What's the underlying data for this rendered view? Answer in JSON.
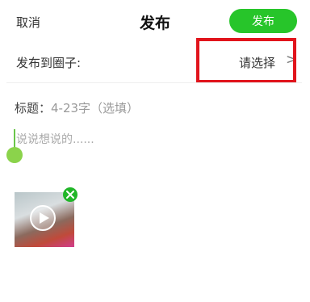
{
  "header": {
    "cancel_label": "取消",
    "title": "发布",
    "publish_label": "发布"
  },
  "circle": {
    "label": "发布到圈子:",
    "value": "请选择",
    "chevron": ">"
  },
  "subject": {
    "label": "标题：",
    "hint": "4-23字（选填）"
  },
  "content": {
    "placeholder": "说说想说的......"
  },
  "media": {
    "icons": [
      "play-icon",
      "remove-icon"
    ]
  },
  "colors": {
    "accent": "#27c52a",
    "highlight": "#e1141c",
    "hint": "#9a9a9a"
  }
}
